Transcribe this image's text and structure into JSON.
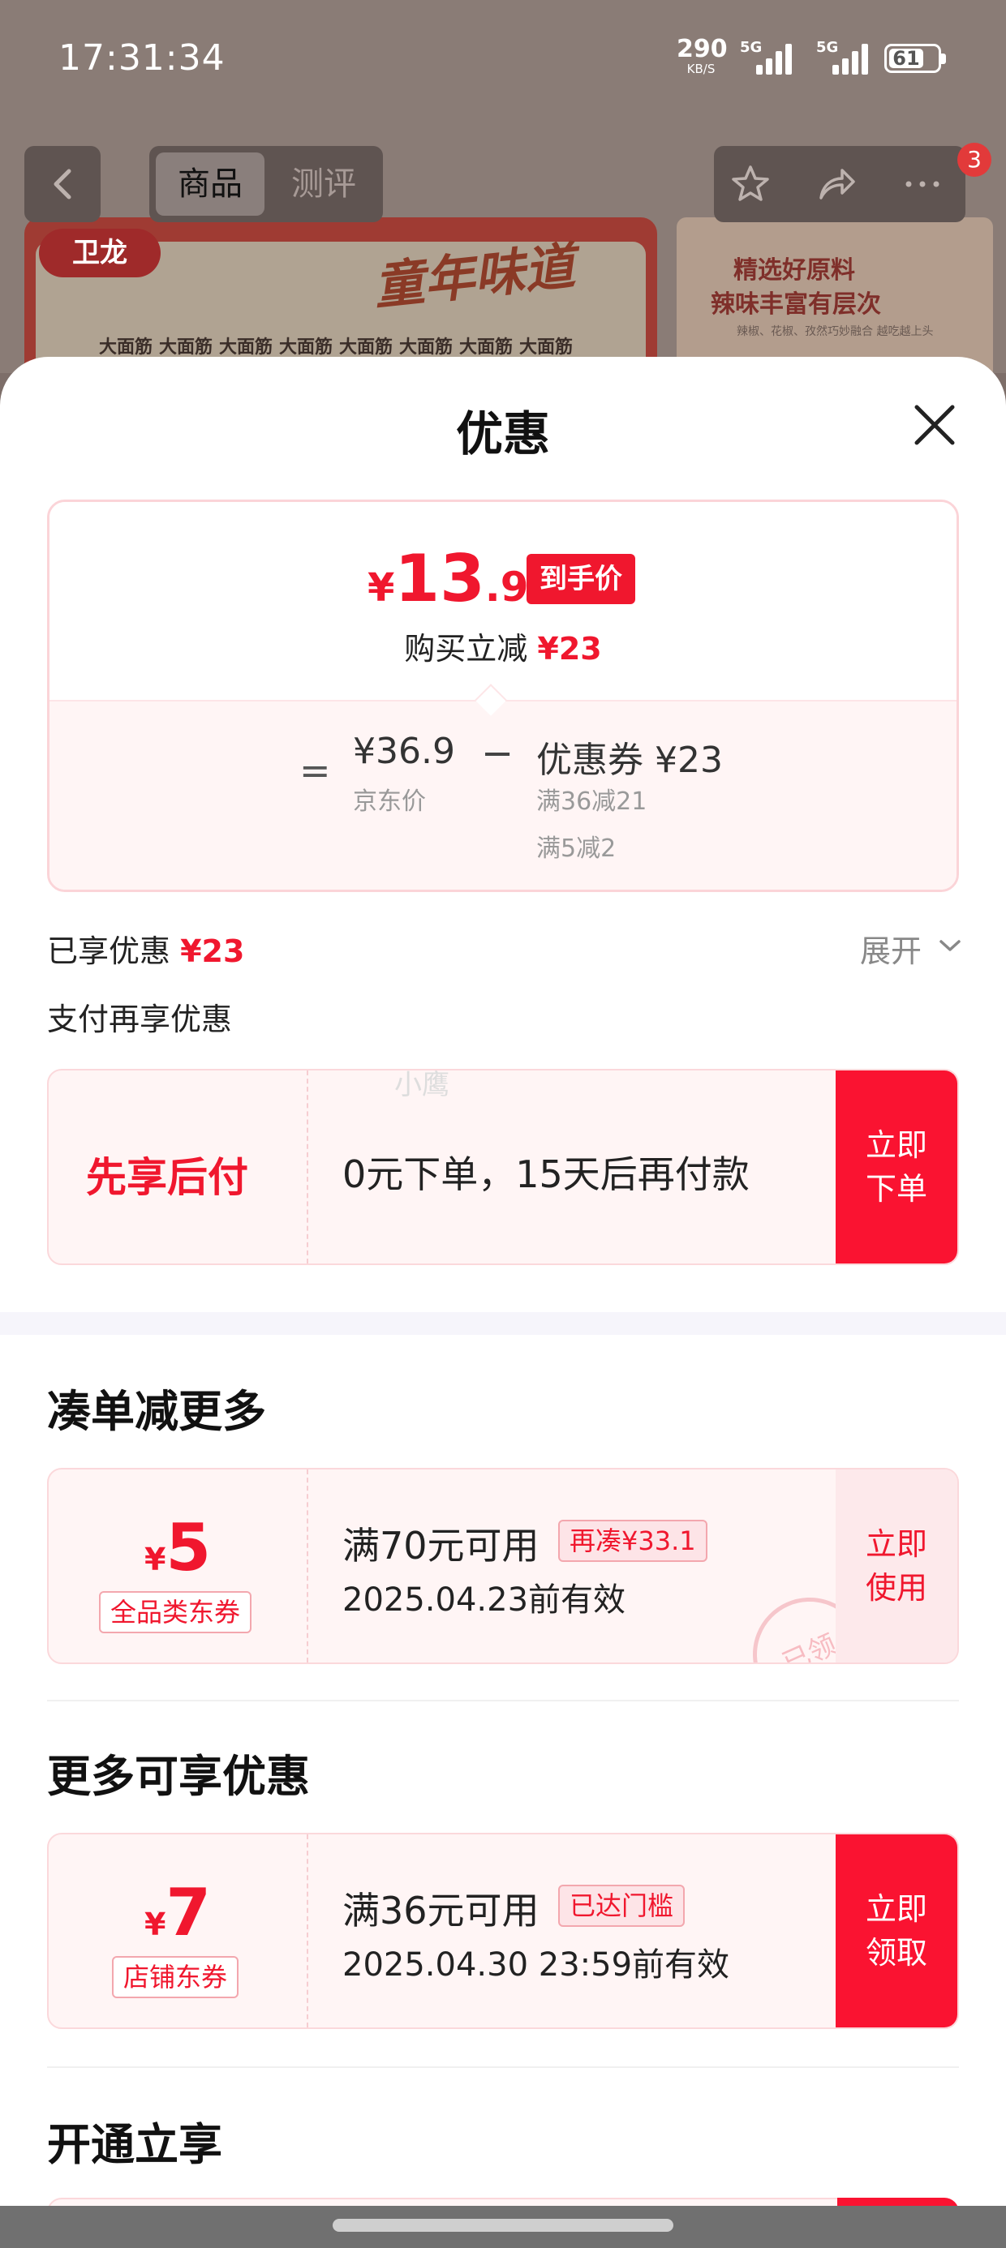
{
  "status_bar": {
    "time": "17:31:34",
    "net_speed": "290",
    "net_unit": "KB/S",
    "sim1_label": "5G",
    "sim2_label": "5G",
    "battery": "61"
  },
  "product_nav": {
    "tab_goods": "商品",
    "tab_review": "测评",
    "cart_badge": "3"
  },
  "banner": {
    "brand": "卫龙",
    "slogan": "童年味道",
    "product_name": "大面筋",
    "right_line1": "精选好原料",
    "right_line2": "辣味丰富有层次",
    "right_line3": "辣椒、花椒、孜然巧妙融合 越吃越上头"
  },
  "sheet": {
    "title": "优惠",
    "price_summary": {
      "currency": "¥",
      "final_int": "13",
      "final_dec": ".9",
      "final_tag": "到手价",
      "reduce_label": "购买立减",
      "reduce_value": "¥23",
      "eq": "=",
      "jd_price": "¥36.9",
      "jd_price_label": "京东价",
      "minus": "−",
      "coupon_total": "优惠券 ¥23",
      "coupon_rule1": "满36减21",
      "coupon_rule2": "满5减2"
    },
    "enjoyed_label": "已享优惠",
    "enjoyed_value": "¥23",
    "expand_label": "展开",
    "pay_more_label": "支付再享优惠",
    "bnpl": {
      "title": "先享后付",
      "desc": "0元下单，15天后再付款",
      "cta": "立即下单",
      "watermark": "小鹰"
    },
    "section_bundle": {
      "title": "凑单减更多",
      "coupon": {
        "currency": "¥",
        "amount": "5",
        "type": "全品类东券",
        "condition": "满70元可用",
        "tag": "再凑¥33.1",
        "validity": "2025.04.23前有效",
        "cta": "立即使用",
        "stamp": "已领"
      }
    },
    "section_more": {
      "title": "更多可享优惠",
      "coupon": {
        "currency": "¥",
        "amount": "7",
        "type": "店铺东券",
        "condition": "满36元可用",
        "tag": "已达门槛",
        "validity": "2025.04.30 23:59前有效",
        "cta": "立即领取"
      }
    },
    "section_open": {
      "title": "开通立享"
    }
  },
  "colors": {
    "accent_red": "#f0172e",
    "cta_red": "#fa1331",
    "card_bg": "#fff5f5",
    "card_border": "#fbd8db"
  }
}
